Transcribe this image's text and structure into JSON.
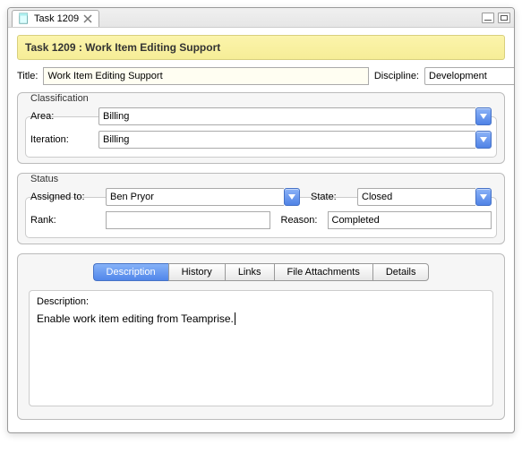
{
  "tab": {
    "title": "Task 1209"
  },
  "header": {
    "text": "Task 1209 : Work Item Editing Support"
  },
  "titleRow": {
    "label": "Title:",
    "value": "Work Item Editing Support",
    "disciplineLabel": "Discipline:",
    "disciplineValue": "Development"
  },
  "classification": {
    "legend": "Classification",
    "areaLabel": "Area:",
    "areaValue": "Billing",
    "iterLabel": "Iteration:",
    "iterValue": "Billing"
  },
  "status": {
    "legend": "Status",
    "assignedLabel": "Assigned to:",
    "assignedValue": "Ben Pryor",
    "stateLabel": "State:",
    "stateValue": "Closed",
    "rankLabel": "Rank:",
    "rankValue": "",
    "reasonLabel": "Reason:",
    "reasonValue": "Completed"
  },
  "tabs": {
    "t0": "Description",
    "t1": "History",
    "t2": "Links",
    "t3": "File Attachments",
    "t4": "Details"
  },
  "description": {
    "label": "Description:",
    "text": "Enable work item editing from Teamprise."
  }
}
